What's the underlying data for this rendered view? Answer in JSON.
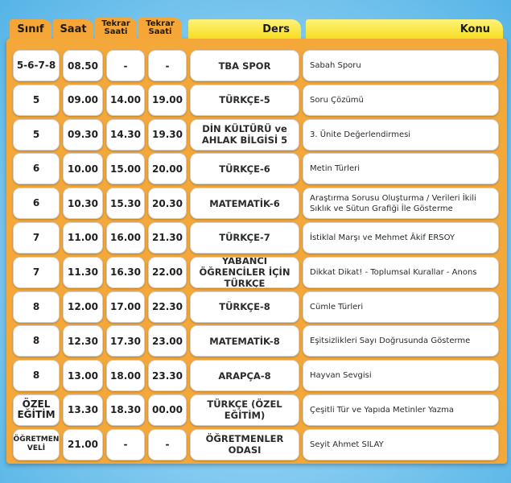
{
  "headers": {
    "sinif": "Sınıf",
    "saat": "Saat",
    "tekrar1": "Tekrar Saati",
    "tekrar2": "Tekrar Saati",
    "ders": "Ders",
    "konu": "Konu"
  },
  "rows": [
    {
      "sinif": "5-6-7-8",
      "saat": "08.50",
      "tekrar1": "-",
      "tekrar2": "-",
      "ders": "TBA SPOR",
      "konu": "Sabah Sporu"
    },
    {
      "sinif": "5",
      "saat": "09.00",
      "tekrar1": "14.00",
      "tekrar2": "19.00",
      "ders": "TÜRKÇE-5",
      "konu": "Soru Çözümü"
    },
    {
      "sinif": "5",
      "saat": "09.30",
      "tekrar1": "14.30",
      "tekrar2": "19.30",
      "ders": "DİN KÜLTÜRÜ ve AHLAK BİLGİSİ 5",
      "konu": "3. Ünite Değerlendirmesi"
    },
    {
      "sinif": "6",
      "saat": "10.00",
      "tekrar1": "15.00",
      "tekrar2": "20.00",
      "ders": "TÜRKÇE-6",
      "konu": "Metin Türleri"
    },
    {
      "sinif": "6",
      "saat": "10.30",
      "tekrar1": "15.30",
      "tekrar2": "20.30",
      "ders": "MATEMATİK-6",
      "konu": "Araştırma Sorusu Oluşturma / Verileri İkili Sıklık ve  Sütun Grafiği İle Gösterme"
    },
    {
      "sinif": "7",
      "saat": "11.00",
      "tekrar1": "16.00",
      "tekrar2": "21.30",
      "ders": "TÜRKÇE-7",
      "konu": "İstiklal Marşı ve Mehmet Âkif ERSOY"
    },
    {
      "sinif": "7",
      "saat": "11.30",
      "tekrar1": "16.30",
      "tekrar2": "22.00",
      "ders": "YABANCI ÖĞRENCİLER İÇİN TÜRKÇE",
      "konu": "Dikkat Dikat! - Toplumsal Kurallar - Anons"
    },
    {
      "sinif": "8",
      "saat": "12.00",
      "tekrar1": "17.00",
      "tekrar2": "22.30",
      "ders": "TÜRKÇE-8",
      "konu": "Cümle Türleri"
    },
    {
      "sinif": "8",
      "saat": "12.30",
      "tekrar1": "17.30",
      "tekrar2": "23.00",
      "ders": "MATEMATİK-8",
      "konu": "Eşitsizlikleri Sayı Doğrusunda Gösterme"
    },
    {
      "sinif": "8",
      "saat": "13.00",
      "tekrar1": "18.00",
      "tekrar2": "23.30",
      "ders": "ARAPÇA-8",
      "konu": "Hayvan Sevgisi"
    },
    {
      "sinif": "ÖZEL EĞİTİM",
      "saat": "13.30",
      "tekrar1": "18.30",
      "tekrar2": "00.00",
      "ders": "TÜRKÇE (ÖZEL EĞİTİM)",
      "konu": "Çeşitli Tür ve Yapıda Metinler Yazma"
    },
    {
      "sinif": "ÖĞRETMEN VELİ",
      "saat": "21.00",
      "tekrar1": "-",
      "tekrar2": "-",
      "ders": "ÖĞRETMENLER ODASI",
      "konu": "Seyit Ahmet SILAY"
    }
  ],
  "colors": {
    "board": "#f5a83a",
    "tab_orange": "#f5a637",
    "tab_yellow": "#f6de22",
    "cell": "#ffffff",
    "background": "#8fd0f3"
  }
}
